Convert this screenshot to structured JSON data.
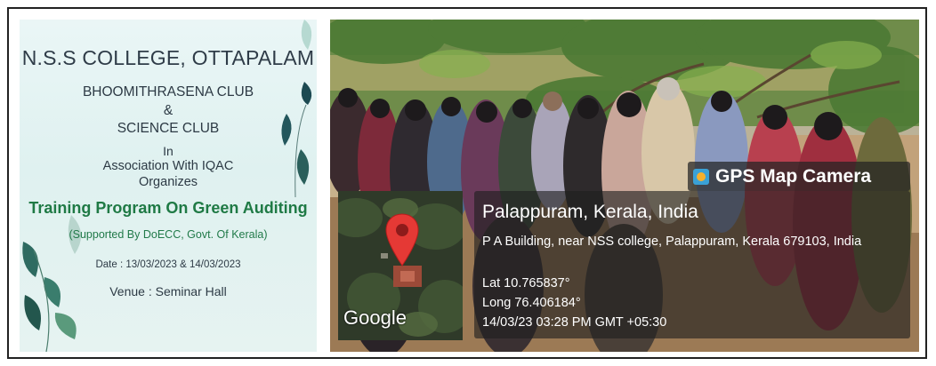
{
  "poster": {
    "college": "N.S.S COLLEGE, OTTAPALAM",
    "club1": "BHOOMITHRASENA CLUB",
    "amp": "&",
    "club2": "SCIENCE CLUB",
    "in": "In",
    "association": "Association With IQAC",
    "organizes": "Organizes",
    "program": "Training Program On Green Auditing",
    "support": "(Supported By DoECC, Govt. Of Kerala)",
    "date": "Date : 13/03/2023 & 14/03/2023",
    "venue": "Venue : Seminar Hall"
  },
  "gps": {
    "app_name": "GPS Map Camera",
    "map_label": "Google",
    "location": "Palappuram, Kerala, India",
    "address": "P A Building, near NSS college, Palappuram, Kerala 679103, India",
    "latitude": "Lat 10.765837°",
    "longitude": "Long 76.406184°",
    "timestamp": "14/03/23 03:28 PM GMT +05:30"
  },
  "colors": {
    "program_green": "#1f7a45",
    "map_pin": "#e53935"
  }
}
